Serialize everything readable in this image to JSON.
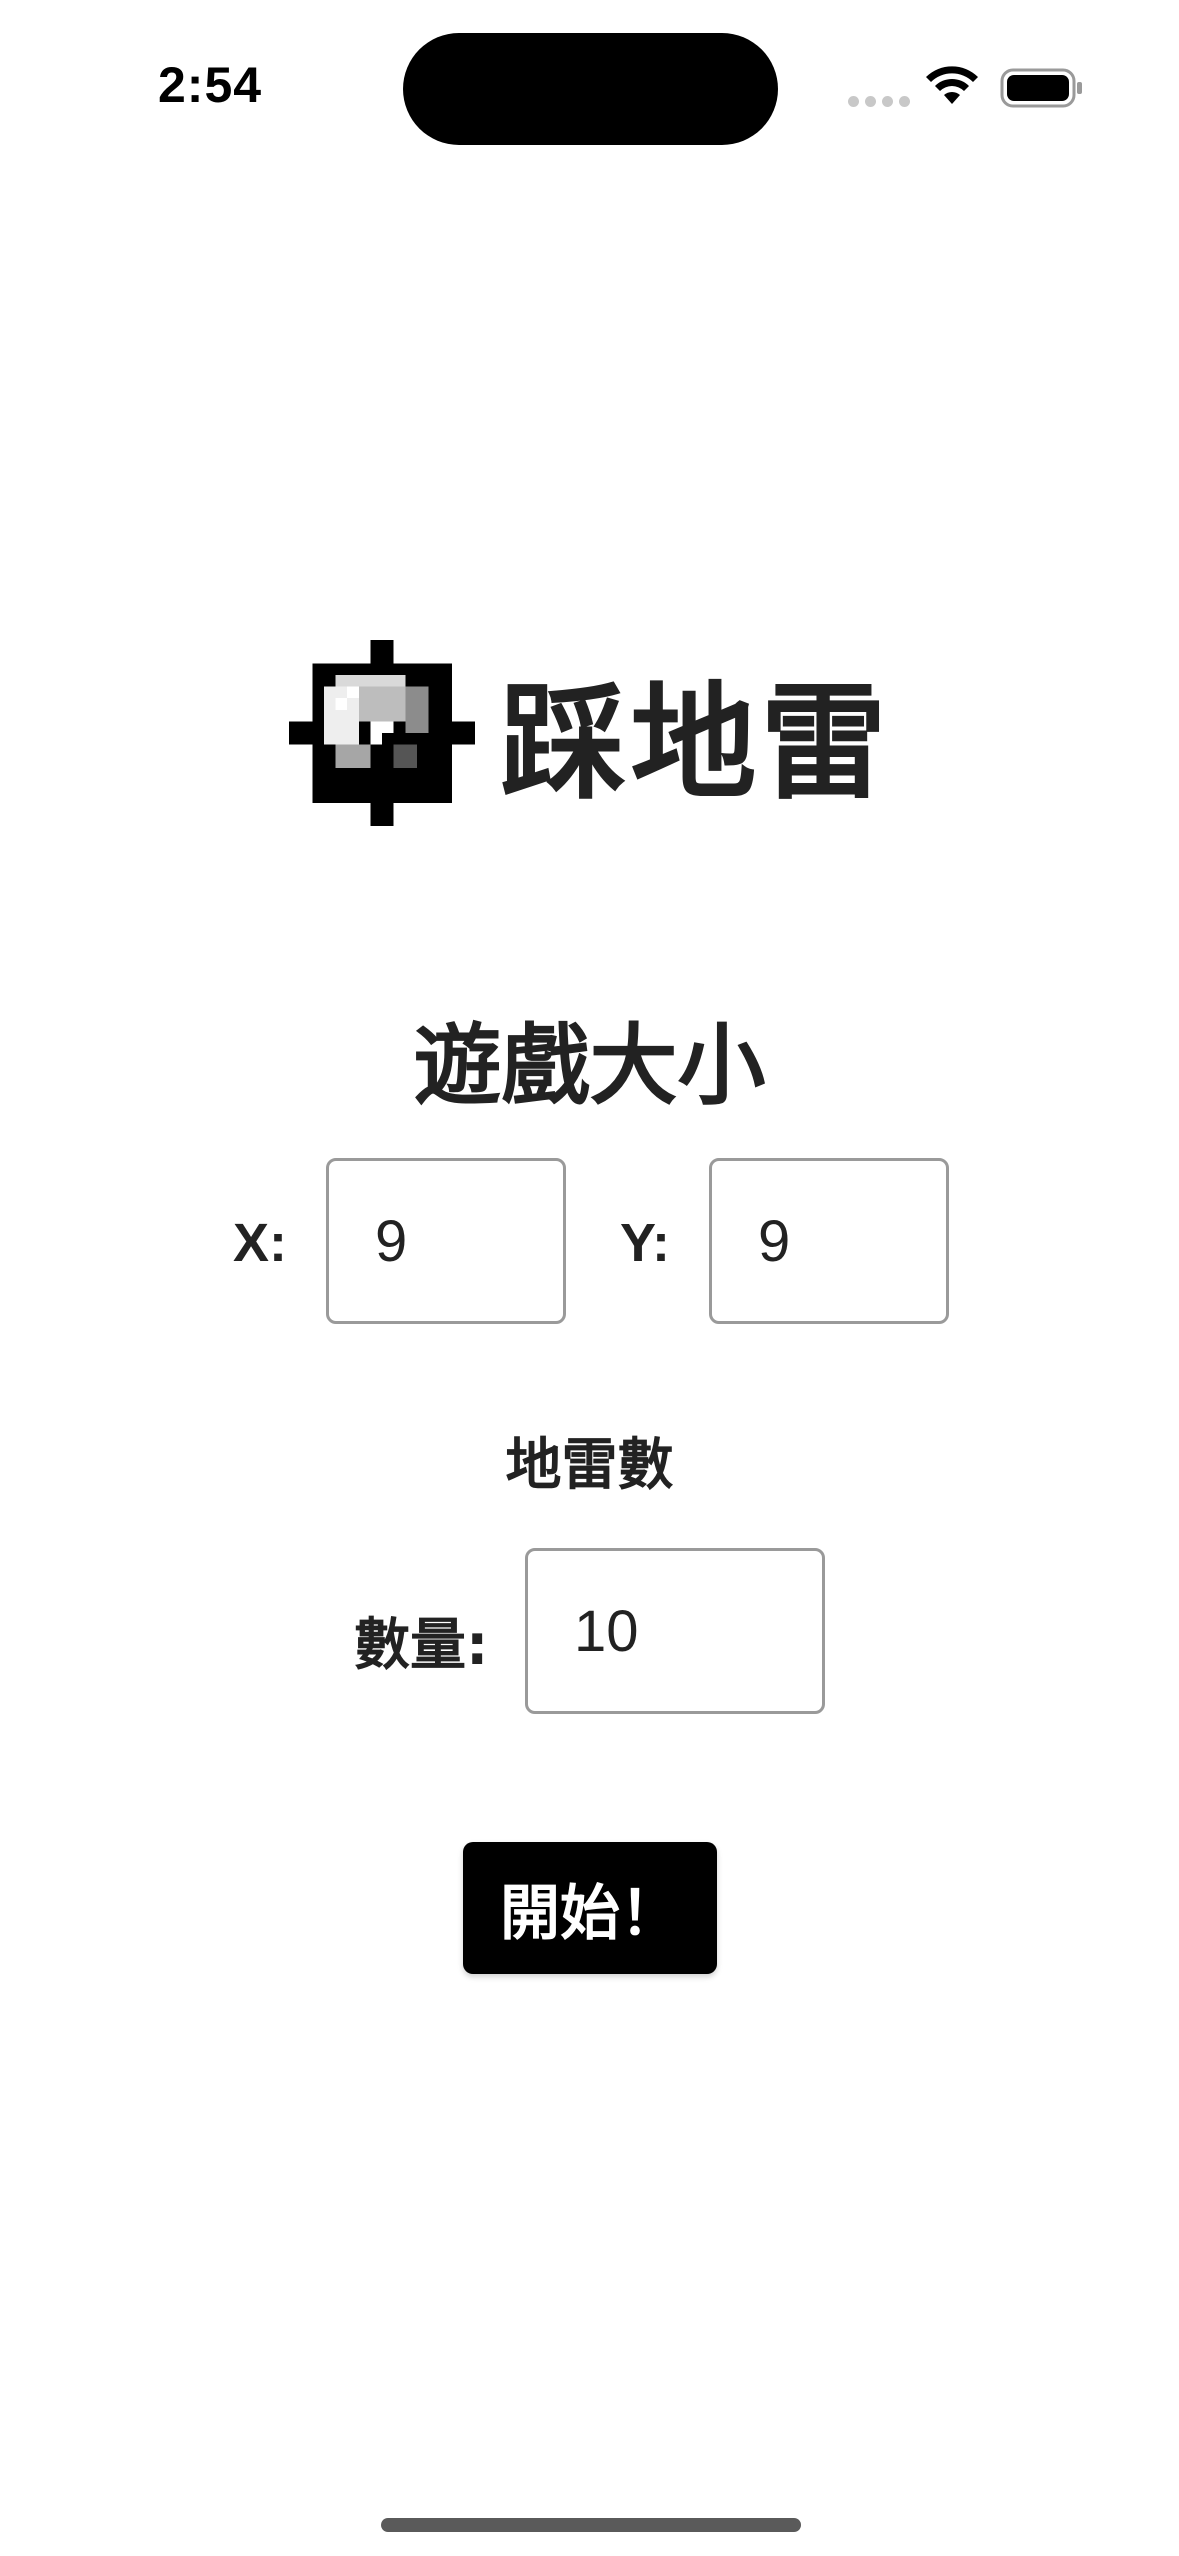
{
  "status_bar": {
    "time": "2:54",
    "icons": [
      "cellular-signal-icon",
      "wifi-icon",
      "battery-icon"
    ]
  },
  "app": {
    "title": "踩地雷",
    "logo_icon": "mine-icon"
  },
  "board_size": {
    "heading": "遊戲大小",
    "x_label": "X:",
    "x_value": "9",
    "y_label": "Y:",
    "y_value": "9"
  },
  "mines": {
    "heading": "地雷數",
    "count_label": "數量:",
    "count_value": "10"
  },
  "actions": {
    "start_label": "開始！"
  },
  "colors": {
    "background": "#ffffff",
    "text": "#222222",
    "button_bg": "#000000",
    "button_text": "#ffffff",
    "input_border": "#9a9a9a"
  }
}
